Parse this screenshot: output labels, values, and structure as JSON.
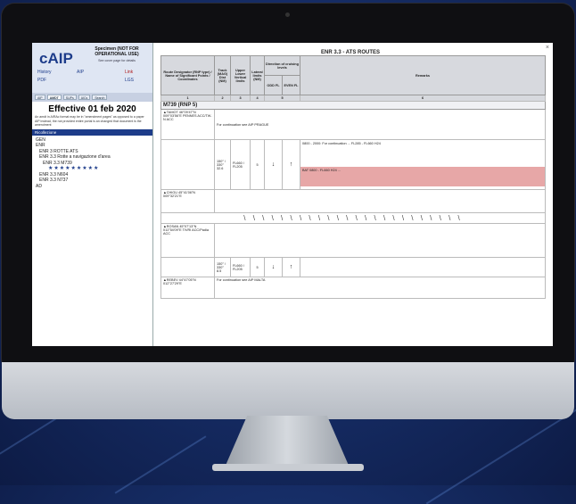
{
  "caip": {
    "logo": "cAIP",
    "specimen": "Specimen (NOT FOR OPERATIONAL USE)",
    "screen_link": "See cover page for details",
    "links": {
      "history": "History",
      "pdf": "PDF",
      "aip_label": "AIP",
      "link_g": "Link",
      "link_c": "LGS"
    },
    "tabs": [
      "AIP",
      "AMDT",
      "SUPs",
      "AICs",
      "Search"
    ],
    "effective": "Effective 01 feb 2020",
    "note": "An amdt in AIRAc format may be in \"amendment pages\" as opposed to a paper AIP instead, the not provided entire portal is an changed that document is the amendment",
    "section": "Ricollezione",
    "tree": [
      {
        "level": 0,
        "text": "GEN"
      },
      {
        "level": 0,
        "text": "ENR"
      },
      {
        "level": 1,
        "text": "ENR 3 ROTTE ATS"
      },
      {
        "level": 2,
        "text": "ENR 3.3 Rotte a navigazione d'area"
      },
      {
        "level": 3,
        "text": "ENR 3.3 M739"
      }
    ],
    "stars": "★★★★★★★★★",
    "tree2": [
      {
        "level": 2,
        "text": "ENR 3.3 N604"
      },
      {
        "level": 2,
        "text": "ENR 3.3 N737"
      },
      {
        "level": 0,
        "text": "AD"
      }
    ]
  },
  "enr": {
    "title": "ENR 3.3 - ATS ROUTES",
    "headers": {
      "designator": "Route Designator (RNP type) / Name of Significant Points / Coordinates",
      "track": "Track (MAG) Dist (NM)",
      "upper": "Upper Lower Vertical limits",
      "lateral": "Lateral limits (NM)",
      "direction": "Direction of cruising levels",
      "odd": "ODD FL",
      "even": "EVEN FL",
      "remarks": "Remarks"
    },
    "numbers": [
      "1",
      "2",
      "3",
      "4",
      "5",
      "6"
    ],
    "route": "M739 (RNP 5)",
    "rows": [
      {
        "point": "▲TAMOT 46°09'47\"N 009°03'56\"E PENNES ACC/TW-N ACC",
        "track": "",
        "limits": "",
        "lateral": "",
        "remark": "For continuation see AIP PRAGUE"
      },
      {
        "point": "",
        "track": "150° / 330° 32.6",
        "limits": "FL660 / FL205",
        "lateral": "5",
        "remark": "0800 - 2000: For continuation ... FL285 - FL660 H24"
      },
      {
        "point": "▲CHIGU 45°41'06\"N 009°32'21\"E",
        "track": "",
        "limits": "",
        "lateral": "",
        "remark": ""
      },
      {
        "point": "▲ROSAN 45°07'13\"N 011°54'09\"E TIVRI ACC/Padia ACC",
        "track": "",
        "limits": "",
        "lateral": "",
        "remark": ""
      },
      {
        "point": "",
        "track": "150° / 330° 8.5",
        "limits": "FL660 / FL205",
        "lateral": "5",
        "remark": ""
      },
      {
        "point": "▲REBEV 44°47'05\"N 012°27'29\"E",
        "track": "",
        "limits": "",
        "lateral": "",
        "remark": "For continuation see AIP MALTA"
      }
    ],
    "remark_labels": [
      "0200",
      "0800",
      "0800",
      "1200 - FL660"
    ],
    "remark_text": "BAT 0800 - FL660 H24 ...",
    "hatch": "\\ \\ \\ \\ \\ \\ \\ \\ \\ \\ \\ \\ \\ \\ \\ \\ \\ \\ \\ \\ \\ \\ \\ \\",
    "close": "×"
  }
}
